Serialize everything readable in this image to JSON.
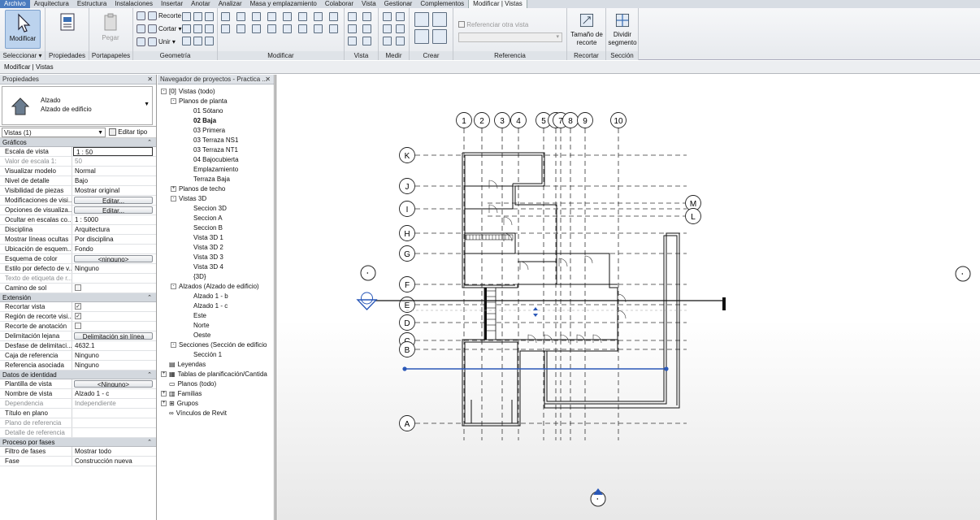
{
  "tabs": [
    "Archivo",
    "Arquitectura",
    "Estructura",
    "Instalaciones",
    "Insertar",
    "Anotar",
    "Analizar",
    "Masa y emplazamiento",
    "Colaborar",
    "Vista",
    "Gestionar",
    "Complementos",
    "Modificar | Vistas"
  ],
  "ribbon": {
    "panels": {
      "seleccionar": "Seleccionar ▾",
      "propiedades": "Propiedades",
      "portapapeles": "Portapapeles",
      "geometria": "Geometría",
      "modificar": "Modificar",
      "vista": "Vista",
      "medir": "Medir",
      "crear": "Crear",
      "referencia": "Referencia",
      "recortar": "Recortar",
      "seccion": "Sección"
    },
    "modificar_btn": "Modificar",
    "pegar": "Pegar",
    "recorte": "Recorte",
    "cortar": "Cortar",
    "unir": "Unir",
    "referenciar_otra_vista": "Referenciar otra vista",
    "tamano_recorte": [
      "Tamaño de",
      "recorte"
    ],
    "dividir_segmento": [
      "Dividir",
      "segmento"
    ]
  },
  "option_bar": "Modificar | Vistas",
  "properties": {
    "title": "Propiedades",
    "type_line1": "Alzado",
    "type_line2": "Alzado de edificio",
    "selector": "Vistas (1)",
    "edit_type": "Editar tipo",
    "sections": [
      {
        "name": "Gráficos",
        "rows": [
          {
            "k": "Escala de vista",
            "v": "1 : 50",
            "kind": "input"
          },
          {
            "k": "Valor de escala    1:",
            "v": "50",
            "kind": "dim"
          },
          {
            "k": "Visualizar modelo",
            "v": "Normal"
          },
          {
            "k": "Nivel de detalle",
            "v": "Bajo"
          },
          {
            "k": "Visibilidad de piezas",
            "v": "Mostrar original"
          },
          {
            "k": "Modificaciones de visi...",
            "v": "Editar...",
            "kind": "btn"
          },
          {
            "k": "Opciones de visualiza...",
            "v": "Editar...",
            "kind": "btn"
          },
          {
            "k": "Ocultar en escalas co...",
            "v": "1 : 5000"
          },
          {
            "k": "Disciplina",
            "v": "Arquitectura"
          },
          {
            "k": "Mostrar líneas ocultas",
            "v": "Por disciplina"
          },
          {
            "k": "Ubicación de esquem...",
            "v": "Fondo"
          },
          {
            "k": "Esquema de color",
            "v": "<ninguno>",
            "kind": "btn"
          },
          {
            "k": "Estilo por defecto de v...",
            "v": "Ninguno"
          },
          {
            "k": "Texto de etiqueta de r...",
            "v": "",
            "kind": "dim"
          },
          {
            "k": "Camino de sol",
            "v": "",
            "kind": "chk"
          }
        ]
      },
      {
        "name": "Extensión",
        "rows": [
          {
            "k": "Recortar vista",
            "v": "",
            "kind": "chkon"
          },
          {
            "k": "Región de recorte visi...",
            "v": "",
            "kind": "chkon"
          },
          {
            "k": "Recorte de anotación",
            "v": "",
            "kind": "chk"
          },
          {
            "k": "Delimitación lejana",
            "v": "Delimitación sin línea",
            "kind": "btn"
          },
          {
            "k": "Desfase de delimitaci...",
            "v": "4632.1"
          },
          {
            "k": "Caja de referencia",
            "v": "Ninguno"
          },
          {
            "k": "Referencia asociada",
            "v": "Ninguno"
          }
        ]
      },
      {
        "name": "Datos de identidad",
        "rows": [
          {
            "k": "Plantilla de vista",
            "v": "<Ninguno>",
            "kind": "btn"
          },
          {
            "k": "Nombre de vista",
            "v": "Alzado 1 - c"
          },
          {
            "k": "Dependencia",
            "v": "Independiente",
            "kind": "dim"
          },
          {
            "k": "Título en plano",
            "v": ""
          },
          {
            "k": "Plano de referencia",
            "v": "",
            "kind": "dim"
          },
          {
            "k": "Detalle de referencia",
            "v": "",
            "kind": "dim"
          }
        ]
      },
      {
        "name": "Proceso por fases",
        "rows": [
          {
            "k": "Filtro de fases",
            "v": "Mostrar todo"
          },
          {
            "k": "Fase",
            "v": "Construcción nueva"
          }
        ]
      }
    ]
  },
  "browser": {
    "title": "Navegador de proyectos - Practica ...",
    "items": [
      {
        "t": "Vistas (todo)",
        "lvl": 0,
        "tg": "-",
        "ic": "[0]"
      },
      {
        "t": "Planos de planta",
        "lvl": 1,
        "tg": "-"
      },
      {
        "t": "01 Sótano",
        "lvl": 2
      },
      {
        "t": "02 Baja",
        "lvl": 2,
        "bold": true
      },
      {
        "t": "03 Primera",
        "lvl": 2
      },
      {
        "t": "03 Terraza NS1",
        "lvl": 2
      },
      {
        "t": "03 Terraza NT1",
        "lvl": 2
      },
      {
        "t": "04 Bajocubierta",
        "lvl": 2
      },
      {
        "t": "Emplazamiento",
        "lvl": 2
      },
      {
        "t": "Terraza Baja",
        "lvl": 2
      },
      {
        "t": "Planos de techo",
        "lvl": 1,
        "tg": "+"
      },
      {
        "t": "Vistas 3D",
        "lvl": 1,
        "tg": "-"
      },
      {
        "t": "Seccion 3D",
        "lvl": 2
      },
      {
        "t": "Seccion A",
        "lvl": 2
      },
      {
        "t": "Seccion B",
        "lvl": 2
      },
      {
        "t": "Vista 3D 1",
        "lvl": 2
      },
      {
        "t": "Vista 3D 2",
        "lvl": 2
      },
      {
        "t": "Vista 3D 3",
        "lvl": 2
      },
      {
        "t": "Vista 3D 4",
        "lvl": 2
      },
      {
        "t": "{3D}",
        "lvl": 2
      },
      {
        "t": "Alzados (Alzado de edificio)",
        "lvl": 1,
        "tg": "-"
      },
      {
        "t": "Alzado 1 - b",
        "lvl": 2
      },
      {
        "t": "Alzado 1 - c",
        "lvl": 2
      },
      {
        "t": "Este",
        "lvl": 2
      },
      {
        "t": "Norte",
        "lvl": 2
      },
      {
        "t": "Oeste",
        "lvl": 2
      },
      {
        "t": "Secciones (Sección de edificio",
        "lvl": 1,
        "tg": "-"
      },
      {
        "t": "Sección 1",
        "lvl": 2
      },
      {
        "t": "Leyendas",
        "lvl": 0,
        "ic": "▤"
      },
      {
        "t": "Tablas de planificación/Cantida",
        "lvl": 0,
        "tg": "+",
        "ic": "▦"
      },
      {
        "t": "Planos (todo)",
        "lvl": 0,
        "ic": "▭"
      },
      {
        "t": "Familias",
        "lvl": 0,
        "tg": "+",
        "ic": "▥"
      },
      {
        "t": "Grupos",
        "lvl": 0,
        "tg": "+",
        "ic": "⊞"
      },
      {
        "t": "Vínculos de Revit",
        "lvl": 0,
        "ic": "∞"
      }
    ]
  },
  "drawing": {
    "v_grids": [
      "1",
      "2",
      "3",
      "4",
      "5",
      "6",
      "7",
      "8",
      "9",
      "10"
    ],
    "h_grids": [
      "K",
      "J",
      "I",
      "H",
      "G",
      "F",
      "E",
      "D",
      "C",
      "B",
      "A",
      "M",
      "L"
    ]
  }
}
